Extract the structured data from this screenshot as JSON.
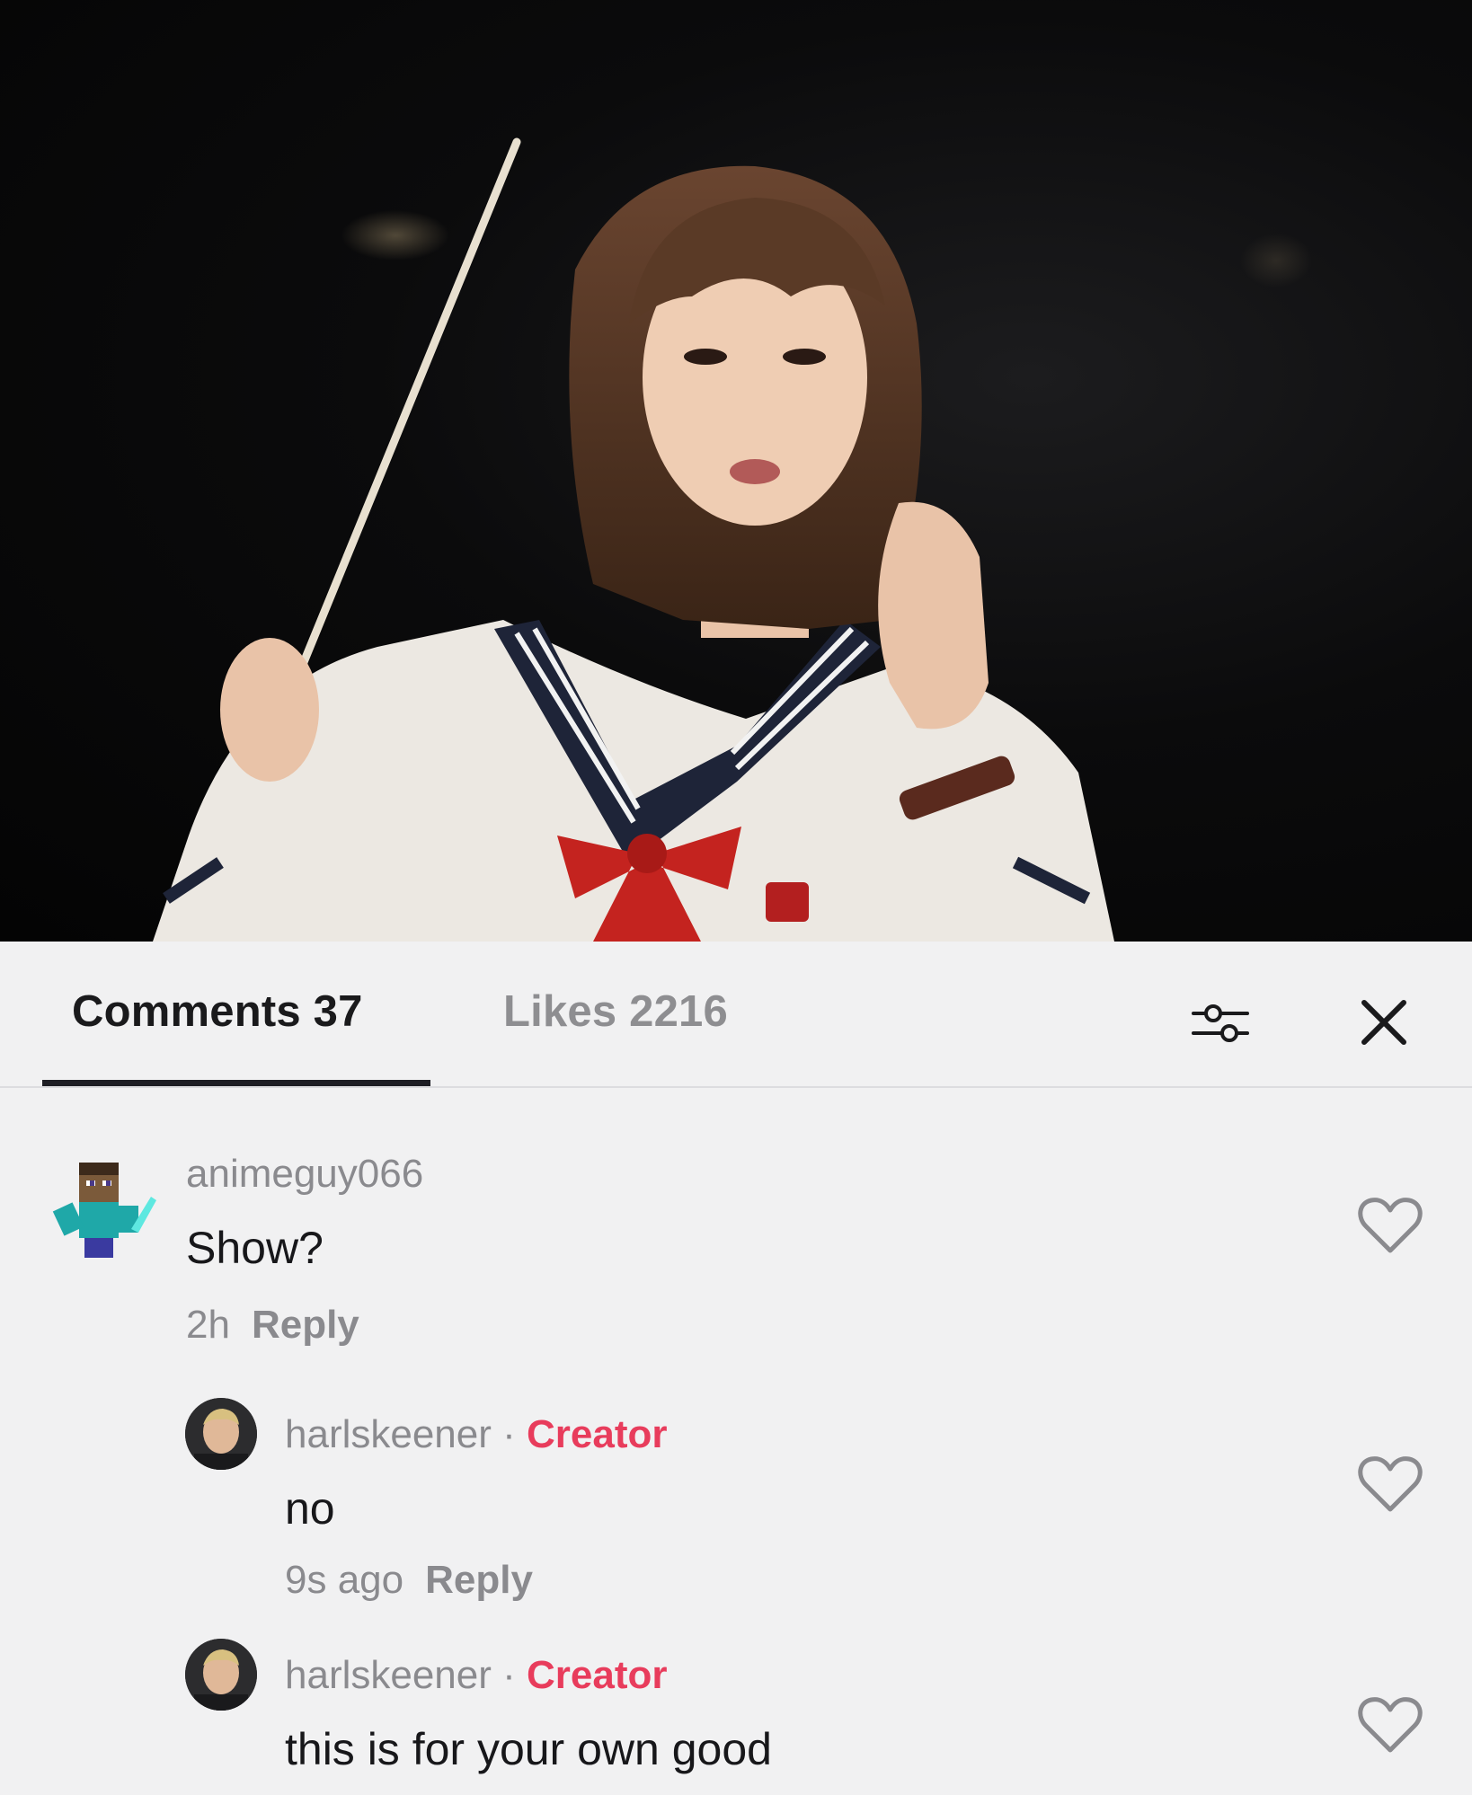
{
  "tabs": {
    "comments_label": "Comments 37",
    "likes_label": "Likes 2216"
  },
  "icons": {
    "filter": "sliders-icon",
    "close": "close-icon",
    "like": "heart-outline-icon"
  },
  "colors": {
    "creator_badge": "#e83c5c",
    "muted_text": "#8a8a8e",
    "active_tab_underline": "#1e1e24",
    "sheet_background": "#f1f1f2"
  },
  "comments": [
    {
      "username": "animeguy066",
      "text": "Show?",
      "time": "2h",
      "reply_label": "Reply"
    },
    {
      "username": "harlskeener",
      "separator": "·",
      "badge": "Creator",
      "text": "no",
      "time": "9s ago",
      "reply_label": "Reply"
    },
    {
      "username": "harlskeener",
      "separator": "·",
      "badge": "Creator",
      "text": "this is for your own good"
    }
  ]
}
